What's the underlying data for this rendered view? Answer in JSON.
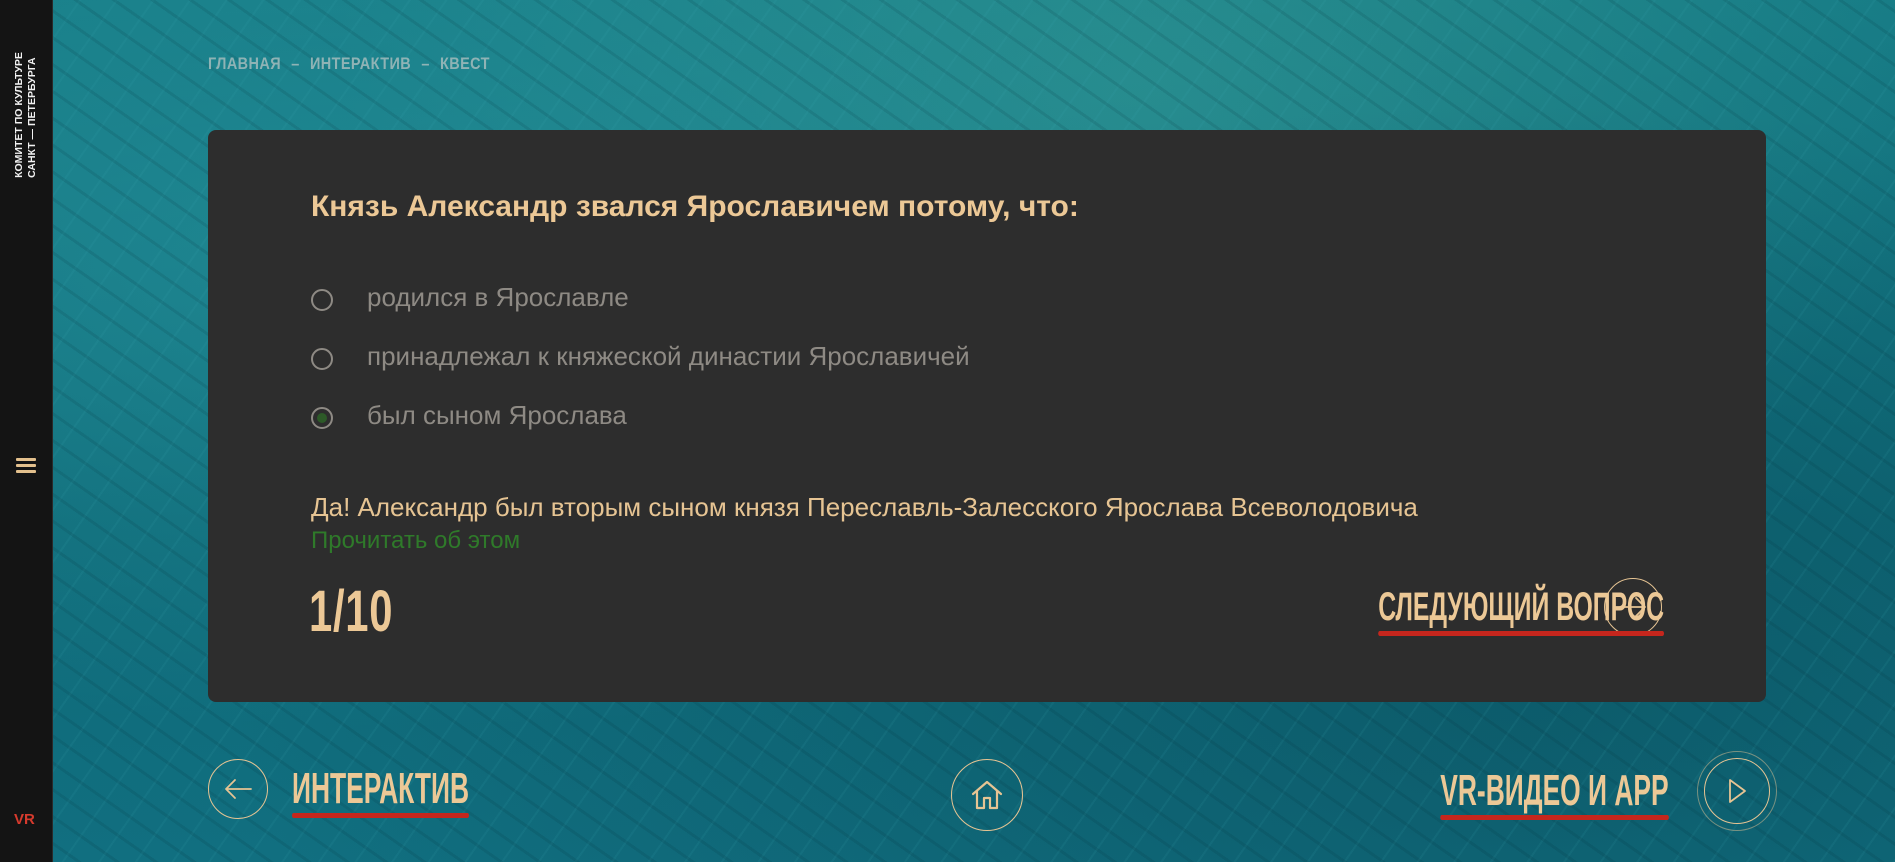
{
  "sidebar": {
    "org_line1": "КОМИТЕТ ПО КУЛЬТУРЕ",
    "org_line2": "САНКТ — ПЕТЕРБУРГА",
    "menu_icon": "hamburger-menu-icon",
    "vr_label": "VR"
  },
  "breadcrumb": {
    "items": [
      "ГЛАВНАЯ",
      "ИНТЕРАКТИВ",
      "КВЕСТ"
    ],
    "separator": "–"
  },
  "quiz": {
    "question": "Князь Александр звался Ярославичем потому, что:",
    "options": [
      {
        "label": "родился в Ярославле",
        "selected": false
      },
      {
        "label": "принадлежал к княжеской династии Ярославичей",
        "selected": false
      },
      {
        "label": "был сыном Ярослава",
        "selected": true
      }
    ],
    "feedback": "Да! Александр был вторым сыном князя Переславль-Залесского Ярослава Всеволодовича",
    "read_more": "Прочитать об этом",
    "progress": "1/10",
    "next_label": "СЛЕДУЮЩИЙ ВОПРОС",
    "next_icon": "arrow-right-icon"
  },
  "bottom_nav": {
    "prev_label": "ИНТЕРАКТИВ",
    "prev_icon": "arrow-left-icon",
    "home_icon": "home-icon",
    "next_label": "VR-ВИДЕО И APP",
    "next_icon": "play-icon"
  },
  "colors": {
    "accent": "#ecc896",
    "underline": "#c5261d",
    "card_bg": "#2d2d2d",
    "sidebar_bg": "#141414",
    "link_green": "#2f7a2a",
    "vr_red": "#d63a2d"
  }
}
